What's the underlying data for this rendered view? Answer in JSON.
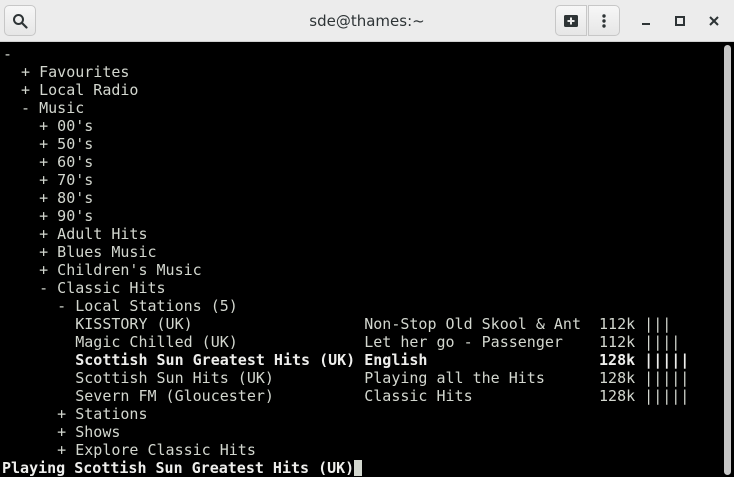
{
  "window": {
    "title": "sde@thames:~"
  },
  "icons": {
    "search": "search-icon",
    "new_tab": "new-tab-icon",
    "menu": "kebab-menu-icon",
    "minimize": "minimize-icon",
    "maximize": "maximize-icon",
    "close": "close-icon"
  },
  "terminal": {
    "lines": [
      "-",
      "  + Favourites",
      "  + Local Radio",
      "  - Music",
      "    + 00's",
      "    + 50's",
      "    + 60's",
      "    + 70's",
      "    + 80's",
      "    + 90's",
      "    + Adult Hits",
      "    + Blues Music",
      "    + Children's Music",
      "    - Classic Hits",
      "      - Local Stations (5)",
      "        KISSTORY (UK)                   Non-Stop Old Skool & Ant  112k |||",
      "        Magic Chilled (UK)              Let her go - Passenger    112k ||||",
      "        Scottish Sun Greatest Hits (UK) English                   128k |||||",
      "        Scottish Sun Hits (UK)          Playing all the Hits      128k |||||",
      "        Severn FM (Gloucester)          Classic Hits              128k |||||",
      "      + Stations",
      "      + Shows",
      "      + Explore Classic Hits"
    ],
    "status_line": "Playing Scottish Sun Greatest Hits (UK)"
  }
}
